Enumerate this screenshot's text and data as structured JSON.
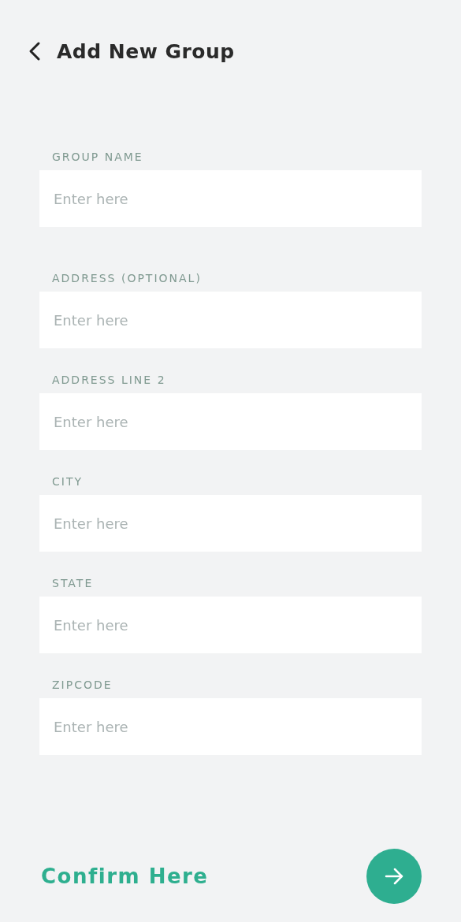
{
  "header": {
    "title": "Add New Group"
  },
  "fields": [
    {
      "label": "GROUP NAME",
      "placeholder": "Enter here"
    },
    {
      "label": "ADDRESS (OPTIONAL)",
      "placeholder": "Enter here"
    },
    {
      "label": "ADDRESS LINE 2",
      "placeholder": "Enter here"
    },
    {
      "label": "CITY",
      "placeholder": "Enter here"
    },
    {
      "label": "STATE",
      "placeholder": "Enter here"
    },
    {
      "label": "ZIPCODE",
      "placeholder": "Enter here"
    }
  ],
  "footer": {
    "confirm_text": "Confirm Here"
  }
}
